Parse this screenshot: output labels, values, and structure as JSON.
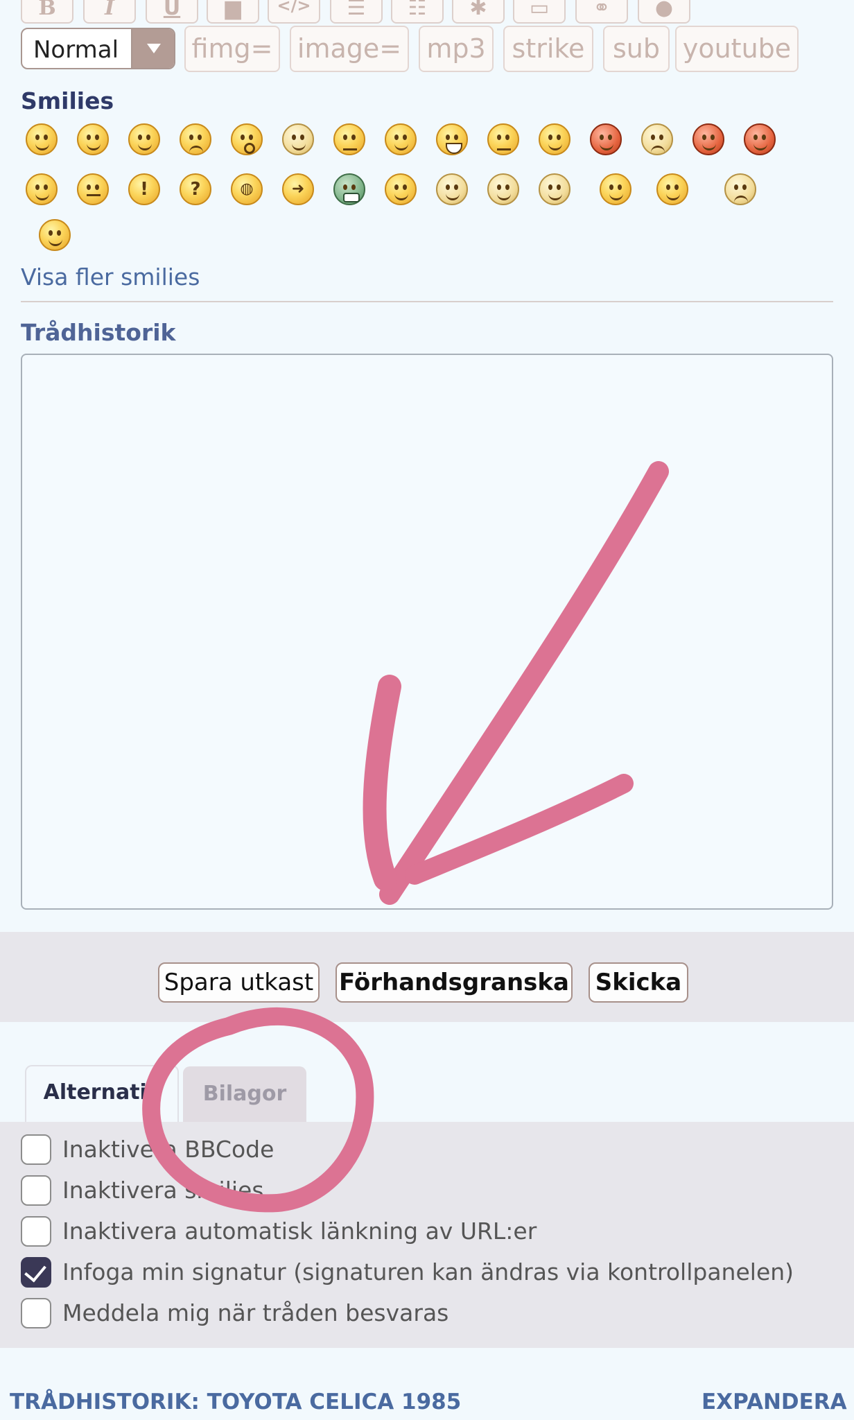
{
  "toolbar": {
    "format_buttons": [
      {
        "label": "B",
        "icon": "bold-icon"
      },
      {
        "label": "I",
        "icon": "italic-icon"
      },
      {
        "label": "U",
        "icon": "underline-icon"
      },
      {
        "label": "",
        "icon": "quote-icon"
      },
      {
        "label": "</>",
        "icon": "code-icon"
      },
      {
        "label": "",
        "icon": "bulleted-list-icon"
      },
      {
        "label": "",
        "icon": "numbered-list-icon"
      },
      {
        "label": "",
        "icon": "star-icon"
      },
      {
        "label": "",
        "icon": "image-icon"
      },
      {
        "label": "",
        "icon": "link-icon"
      },
      {
        "label": "",
        "icon": "color-icon"
      }
    ],
    "font_size_selected": "Normal",
    "tag_buttons": [
      "fimg=",
      "image=",
      "mp3",
      "strike",
      "sub",
      "youtube"
    ]
  },
  "smilies": {
    "heading": "Smilies",
    "icons": [
      "grin-smiley-icon",
      "smile-smiley-icon",
      "wink-smiley-icon",
      "sad-smiley-icon",
      "surprised-smiley-icon",
      "eek-smiley-icon",
      "confused-smiley-icon",
      "cool-smiley-icon",
      "laugh-smiley-icon",
      "mad-smiley-icon",
      "razz-smiley-icon",
      "embarrassed-smiley-icon",
      "cry-smiley-icon",
      "evil-smiley-icon",
      "twisted-smiley-icon",
      "roll-eyes-smiley-icon",
      "neutral-smiley-icon",
      "exclaim-smiley-icon",
      "question-smiley-icon",
      "idea-smiley-icon",
      "arrow-smiley-icon",
      "green-grin-smiley-icon",
      "geek-smiley-icon",
      "nerd-smiley-icon",
      "monocle-smiley-icon",
      "sick-smiley-icon",
      "hug-smiley-icon",
      "kiss-smiley-icon",
      "thumbs-down-smiley-icon",
      "thumbs-up-smiley-icon"
    ],
    "show_more": "Visa fler smilies"
  },
  "thread_history": {
    "heading": "Trådhistorik"
  },
  "actions": {
    "save_draft": "Spara utkast",
    "preview": "Förhandsgranska",
    "send": "Skicka"
  },
  "tabs": {
    "options": "Alternativ",
    "attachments": "Bilagor"
  },
  "options": [
    {
      "label": "Inaktivera BBCode",
      "checked": false
    },
    {
      "label": "Inaktivera smilies",
      "checked": false
    },
    {
      "label": "Inaktivera automatisk länkning av URL:er",
      "checked": false
    },
    {
      "label": "Infoga min signatur (signaturen kan ändras via kontrollpanelen)",
      "checked": true
    },
    {
      "label": "Meddela mig när tråden besvaras",
      "checked": false
    }
  ],
  "footer": {
    "title": "TRÅDHISTORIK: TOYOTA CELICA 1985",
    "expand": "EXPANDERA"
  },
  "colors": {
    "page_bg": "#f2f9fd",
    "heading_dark": "#2f3a68",
    "link_blue": "#4a6aa0",
    "annotation_pink": "#dc7393"
  }
}
